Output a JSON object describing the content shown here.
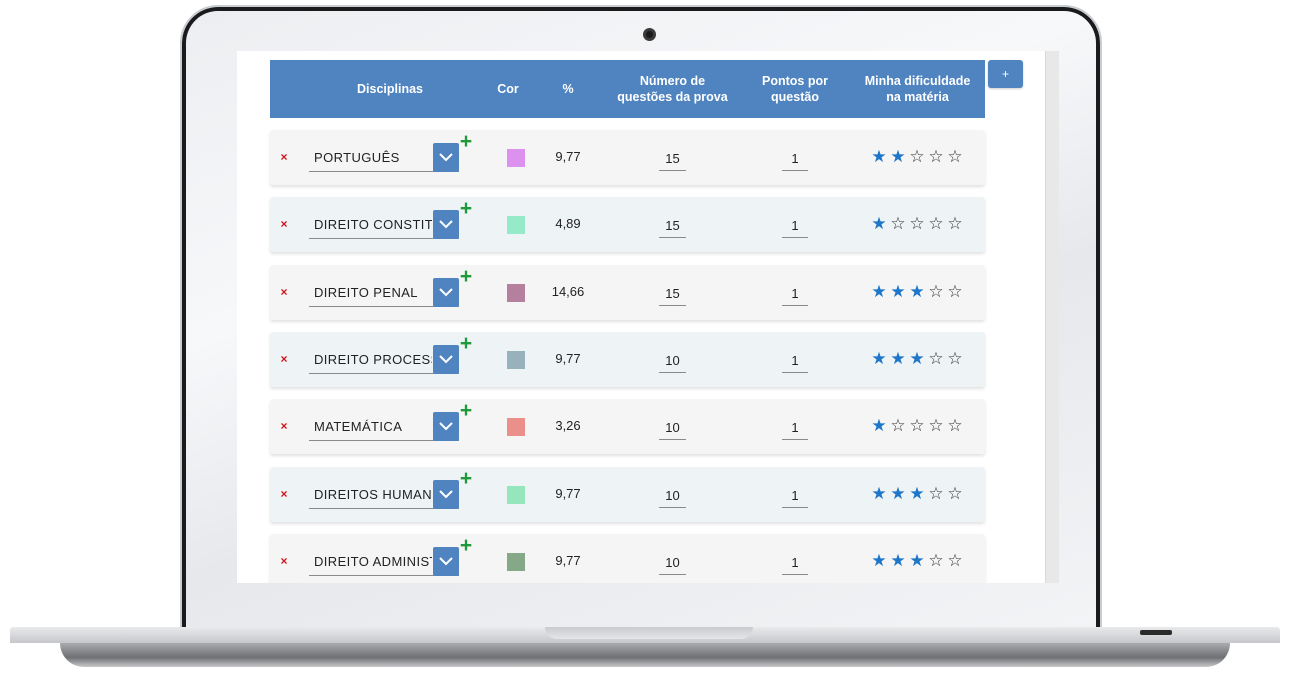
{
  "header": {
    "disciplinas": "Disciplinas",
    "cor": "Cor",
    "percent": "%",
    "numero_questoes_line1": "Número de",
    "numero_questoes_line2": "questões da prova",
    "pontos_line1": "Pontos por",
    "pontos_line2": "questão",
    "dificuldade_line1": "Minha dificuldade",
    "dificuldade_line2": "na matéria",
    "add_button": "+"
  },
  "icons": {
    "remove": "×",
    "add": "+",
    "star_filled": "★",
    "star_empty": "☆"
  },
  "colors": {
    "header_blue": "#4f84c1",
    "star_blue": "#1e76c8",
    "remove_red": "#d0141a",
    "add_green": "#1f9a3a"
  },
  "rows": [
    {
      "subject": "PORTUGUÊS",
      "color": "#dd91ee",
      "percent": "9,77",
      "questions": "15",
      "points": "1",
      "difficulty": 2
    },
    {
      "subject": "DIREITO CONSTITUCIONAL",
      "color": "#95ebc9",
      "percent": "4,89",
      "questions": "15",
      "points": "1",
      "difficulty": 1
    },
    {
      "subject": "DIREITO PENAL",
      "color": "#b4809d",
      "percent": "14,66",
      "questions": "15",
      "points": "1",
      "difficulty": 3
    },
    {
      "subject": "DIREITO PROCESSUAL",
      "color": "#97b1bd",
      "percent": "9,77",
      "questions": "10",
      "points": "1",
      "difficulty": 3
    },
    {
      "subject": "MATEMÁTICA",
      "color": "#ea8f8a",
      "percent": "3,26",
      "questions": "10",
      "points": "1",
      "difficulty": 1
    },
    {
      "subject": "DIREITOS HUMANOS",
      "color": "#95e6bd",
      "percent": "9,77",
      "questions": "10",
      "points": "1",
      "difficulty": 3
    },
    {
      "subject": "DIREITO ADMINISTRATIVO",
      "color": "#84a888",
      "percent": "9,77",
      "questions": "10",
      "points": "1",
      "difficulty": 3
    }
  ]
}
